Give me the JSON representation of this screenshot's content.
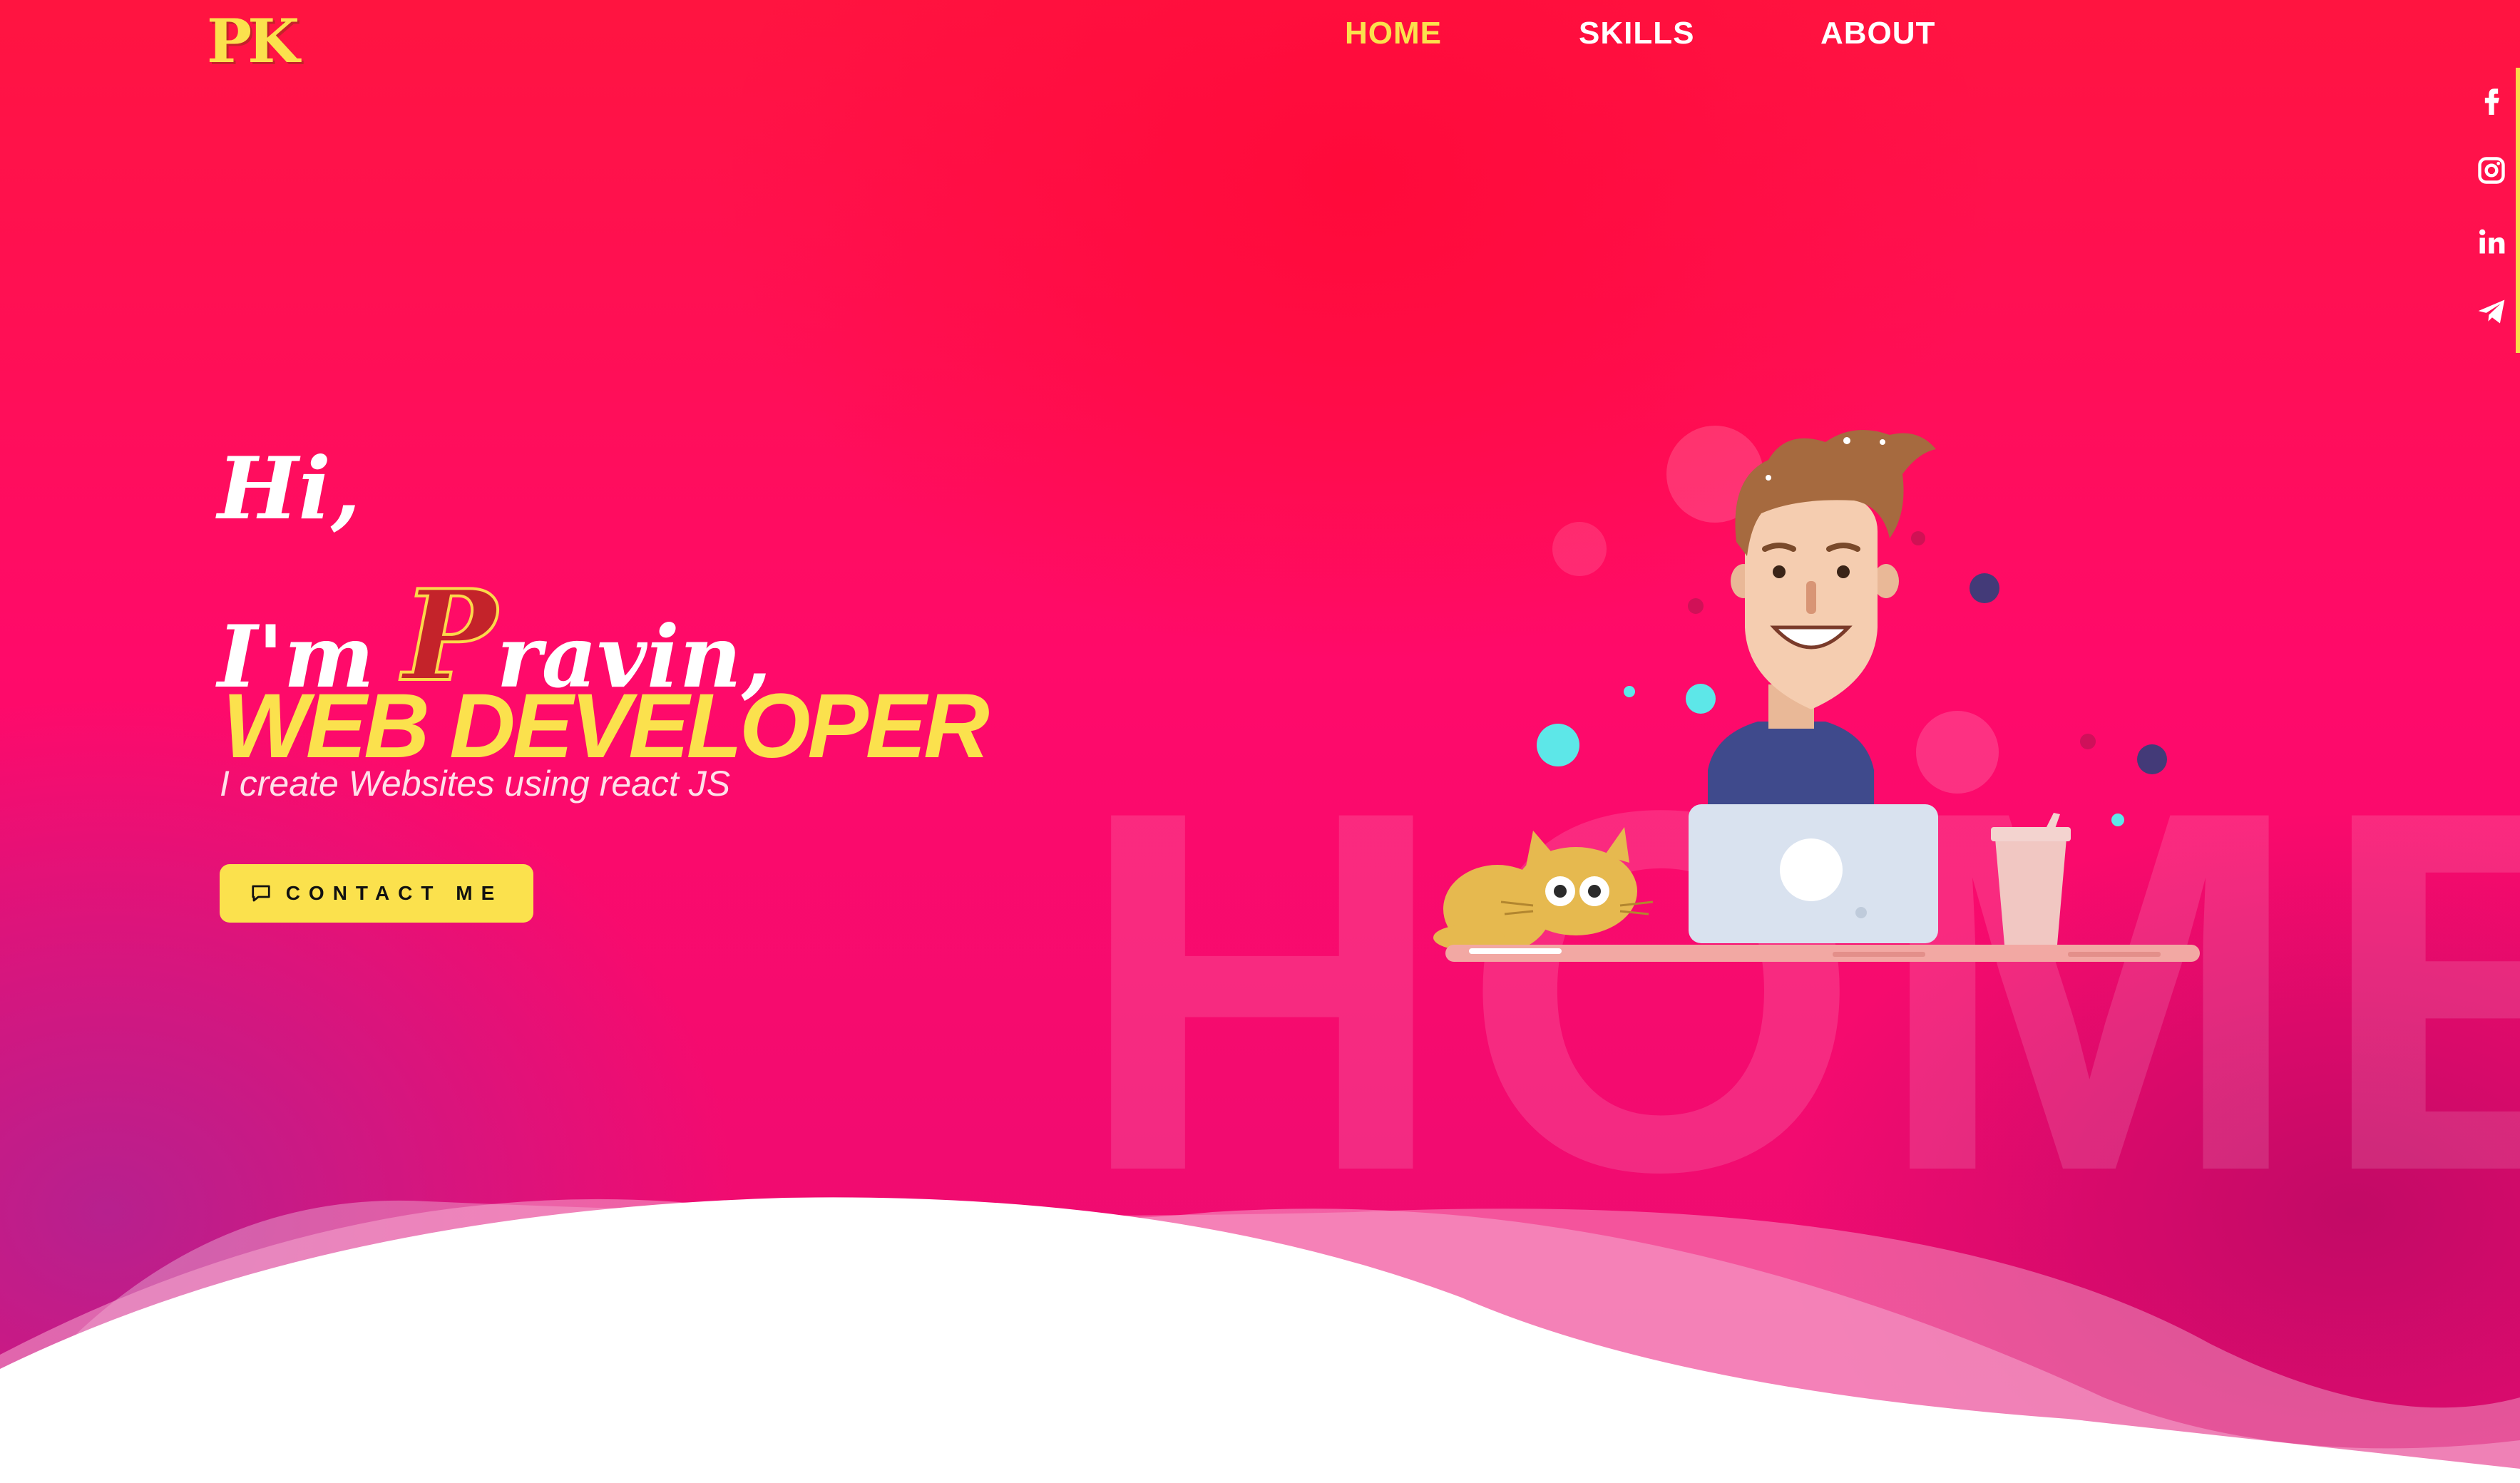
{
  "brand": {
    "logo_text": "PK"
  },
  "nav": {
    "home": "HOME",
    "skills": "SKILLS",
    "about": "ABOUT"
  },
  "social": [
    "facebook-icon",
    "instagram-icon",
    "linkedin-icon",
    "telegram-icon"
  ],
  "hero": {
    "greeting": "Hi,",
    "intro_prefix": "I'm",
    "name_initial": "P",
    "name_rest": "ravin,",
    "role": "WEB DEVELOPER",
    "tagline": "I create Websites using react JS",
    "contact_button": "CONTACT ME",
    "background_word": "HOME"
  },
  "colors": {
    "accent": "#fbe14d",
    "brand_red": "#c4232a",
    "bg_top": "#ff1440",
    "bg_bottom": "#e90c74"
  }
}
